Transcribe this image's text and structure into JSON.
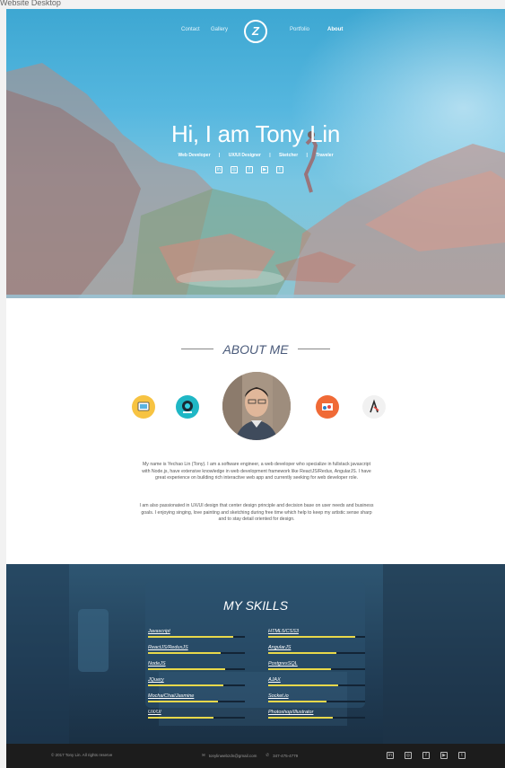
{
  "frame_label": "Website Desktop",
  "nav": {
    "contact": "Contact",
    "gallery": "Gallery",
    "logo": "Z",
    "portfolio": "Portfolio",
    "about": "About"
  },
  "hero": {
    "title": "Hi, I am Tony Lin",
    "roles": [
      "Web Developer",
      "|",
      "UX/UI Designer",
      "|",
      "Sketcher",
      "|",
      "Traveler"
    ],
    "social_icons": [
      "linkedin-icon",
      "instagram-icon",
      "facebook-icon",
      "youtube-icon",
      "twitter-icon"
    ]
  },
  "about": {
    "heading": "ABOUT ME",
    "icons": [
      "design-icon",
      "social-icon",
      "sketch-icon",
      "adobe-icon"
    ],
    "paragraph_1": "My name is Yechao Lin (Tony). I am a software engineer, a web developer who specialize in fullstack javascript with Node.js, have extensive knowledge in web development framework like ReactJS/Redux, AngularJS. I have great experience on building rich interactive web app and currently seeking for web developer role.",
    "paragraph_2": "I am also passionated in UX/UI design that center design principle and decision base on user needs and business goals. I enjoying singing, love painting and sketching during free time which help to keep my artistic sense sharp and to stay detail oriented for design."
  },
  "skills": {
    "heading": "MY SKILLS",
    "left": [
      {
        "name": "Javascript",
        "level": 0.88
      },
      {
        "name": "ReactJS/ReduxJS",
        "level": 0.75
      },
      {
        "name": "NodeJS",
        "level": 0.8
      },
      {
        "name": "JQuery",
        "level": 0.78
      },
      {
        "name": "Mocha/Chai/Jasmine",
        "level": 0.72
      },
      {
        "name": "UX/UI",
        "level": 0.68
      }
    ],
    "right": [
      {
        "name": "HTML5/CSS3",
        "level": 0.9
      },
      {
        "name": "AngularJS",
        "level": 0.7
      },
      {
        "name": "PostgresSQL",
        "level": 0.65
      },
      {
        "name": "AJAX",
        "level": 0.72
      },
      {
        "name": "Socket.io",
        "level": 0.6
      },
      {
        "name": "Photoshop/Illustrator",
        "level": 0.67
      }
    ]
  },
  "footer": {
    "copyright": "© 2017 Tony Lin. All rights reserve",
    "email": "tonylinwebzdn@gmail.com",
    "phone": "347-475-4779",
    "social_icons": [
      "linkedin-icon",
      "instagram-icon",
      "facebook-icon",
      "youtube-icon",
      "twitter-icon"
    ]
  },
  "colors": {
    "skill_fill": "#e8d84a",
    "skills_bg": "#213e57",
    "footer_bg": "#1c1c1c"
  }
}
